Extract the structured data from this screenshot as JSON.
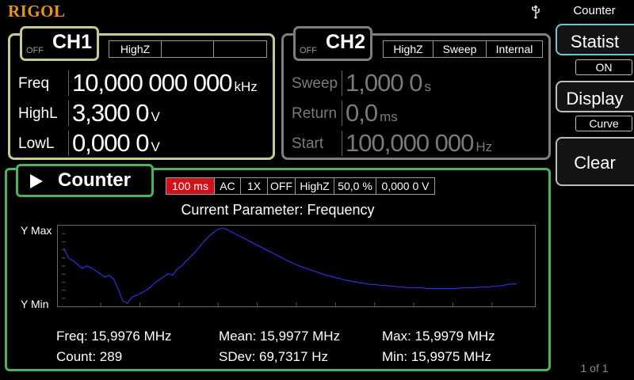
{
  "header": {
    "logo": "RIGOL",
    "usb_icon": "usb-icon"
  },
  "ch1": {
    "off_label": "OFF",
    "name": "CH1",
    "status": [
      "HighZ",
      "",
      ""
    ],
    "params": [
      {
        "label": "Freq",
        "value": "10,000 000 000",
        "unit": "kHz"
      },
      {
        "label": "HighL",
        "value": "3,300 0",
        "unit": "V"
      },
      {
        "label": "LowL",
        "value": "0,000 0",
        "unit": "V"
      }
    ]
  },
  "ch2": {
    "off_label": "OFF",
    "name": "CH2",
    "status": [
      "HighZ",
      "Sweep",
      "Internal"
    ],
    "params": [
      {
        "label": "Sweep",
        "value": "1,000 0",
        "unit": "s"
      },
      {
        "label": "Return",
        "value": "0,0",
        "unit": "ms"
      },
      {
        "label": "Start",
        "value": "100,000 000",
        "unit": "Hz"
      }
    ]
  },
  "menu": {
    "title": "Counter",
    "softkeys": [
      {
        "label": "Statist",
        "sub": "ON"
      },
      {
        "label": "Display",
        "sub": "Curve"
      },
      {
        "label": "Clear"
      }
    ],
    "page_indicator": "1 of 1"
  },
  "counter": {
    "title": "Counter",
    "settings": [
      "100 ms",
      "AC",
      "1X",
      "OFF",
      "HighZ",
      "50,0 %",
      "0,000 0 V"
    ],
    "current_parameter": "Current Parameter: Frequency",
    "y_max_label": "Y Max",
    "y_min_label": "Y Min",
    "stats": {
      "freq": "Freq: 15,9976 MHz",
      "count": "Count: 289",
      "mean": "Mean: 15,9977 MHz",
      "sdev": "SDev: 69,7317 Hz",
      "max": "Max: 15,9979 MHz",
      "min": "Min: 15,9975 MHz"
    }
  },
  "colors": {
    "ch1_border": "#c9c88e",
    "ch2_border": "#7e7e7e",
    "counter_border": "#4bb25e",
    "gate_highlight": "#d0121a",
    "trace": "#2a2fd8",
    "logo": "#e8951e"
  },
  "chart_data": {
    "type": "line",
    "ylim_labels": [
      "Y Min",
      "Y Max"
    ],
    "series": [
      {
        "values": [
          0.73,
          0.6,
          0.57,
          0.52,
          0.47,
          0.5,
          0.48,
          0.44,
          0.4,
          0.36,
          0.38,
          0.33,
          0.2,
          0.05,
          0.02,
          0.1,
          0.12,
          0.15,
          0.18,
          0.22,
          0.28,
          0.32,
          0.36,
          0.4,
          0.38,
          0.46,
          0.5,
          0.56,
          0.62,
          0.68,
          0.75,
          0.82,
          0.88,
          0.93,
          0.97,
          0.99,
          0.97,
          0.94,
          0.91,
          0.88,
          0.85,
          0.82,
          0.79,
          0.76,
          0.73,
          0.7,
          0.67,
          0.64,
          0.61,
          0.58,
          0.55,
          0.53,
          0.5,
          0.48,
          0.46,
          0.44,
          0.42,
          0.4,
          0.38,
          0.37,
          0.35,
          0.34,
          0.32,
          0.31,
          0.3,
          0.29,
          0.28,
          0.27,
          0.26,
          0.26,
          0.25,
          0.25,
          0.24,
          0.24,
          0.23,
          0.23,
          0.22,
          0.22,
          0.22,
          0.22,
          0.21,
          0.21,
          0.21,
          0.21,
          0.21,
          0.21,
          0.21,
          0.21,
          0.22,
          0.22,
          0.22,
          0.22,
          0.23,
          0.23,
          0.23,
          0.24,
          0.24,
          0.25,
          0.26,
          0.27,
          0.27
        ]
      }
    ]
  }
}
